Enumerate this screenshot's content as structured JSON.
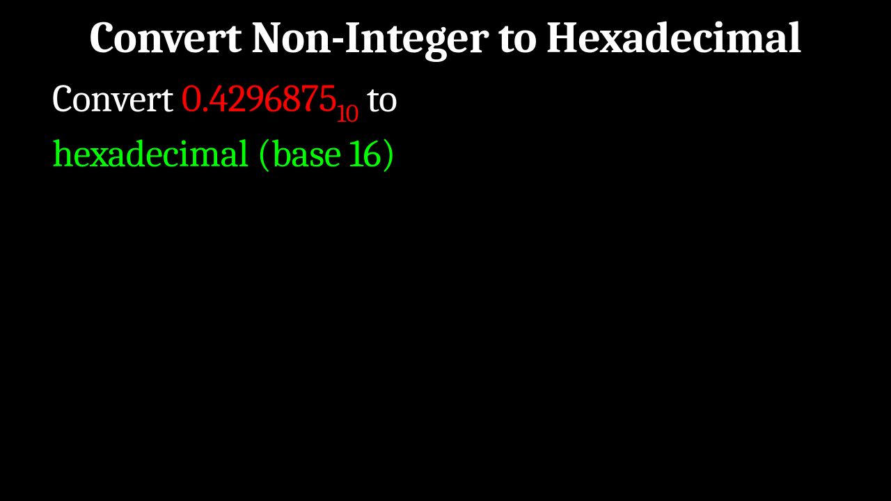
{
  "title": "Convert Non-Integer to Hexadecimal",
  "body": {
    "convert_word": "Convert ",
    "number": "0.4296875",
    "base_subscript": "10",
    "to_word": " to",
    "target": "hexadecimal (base 16)"
  }
}
